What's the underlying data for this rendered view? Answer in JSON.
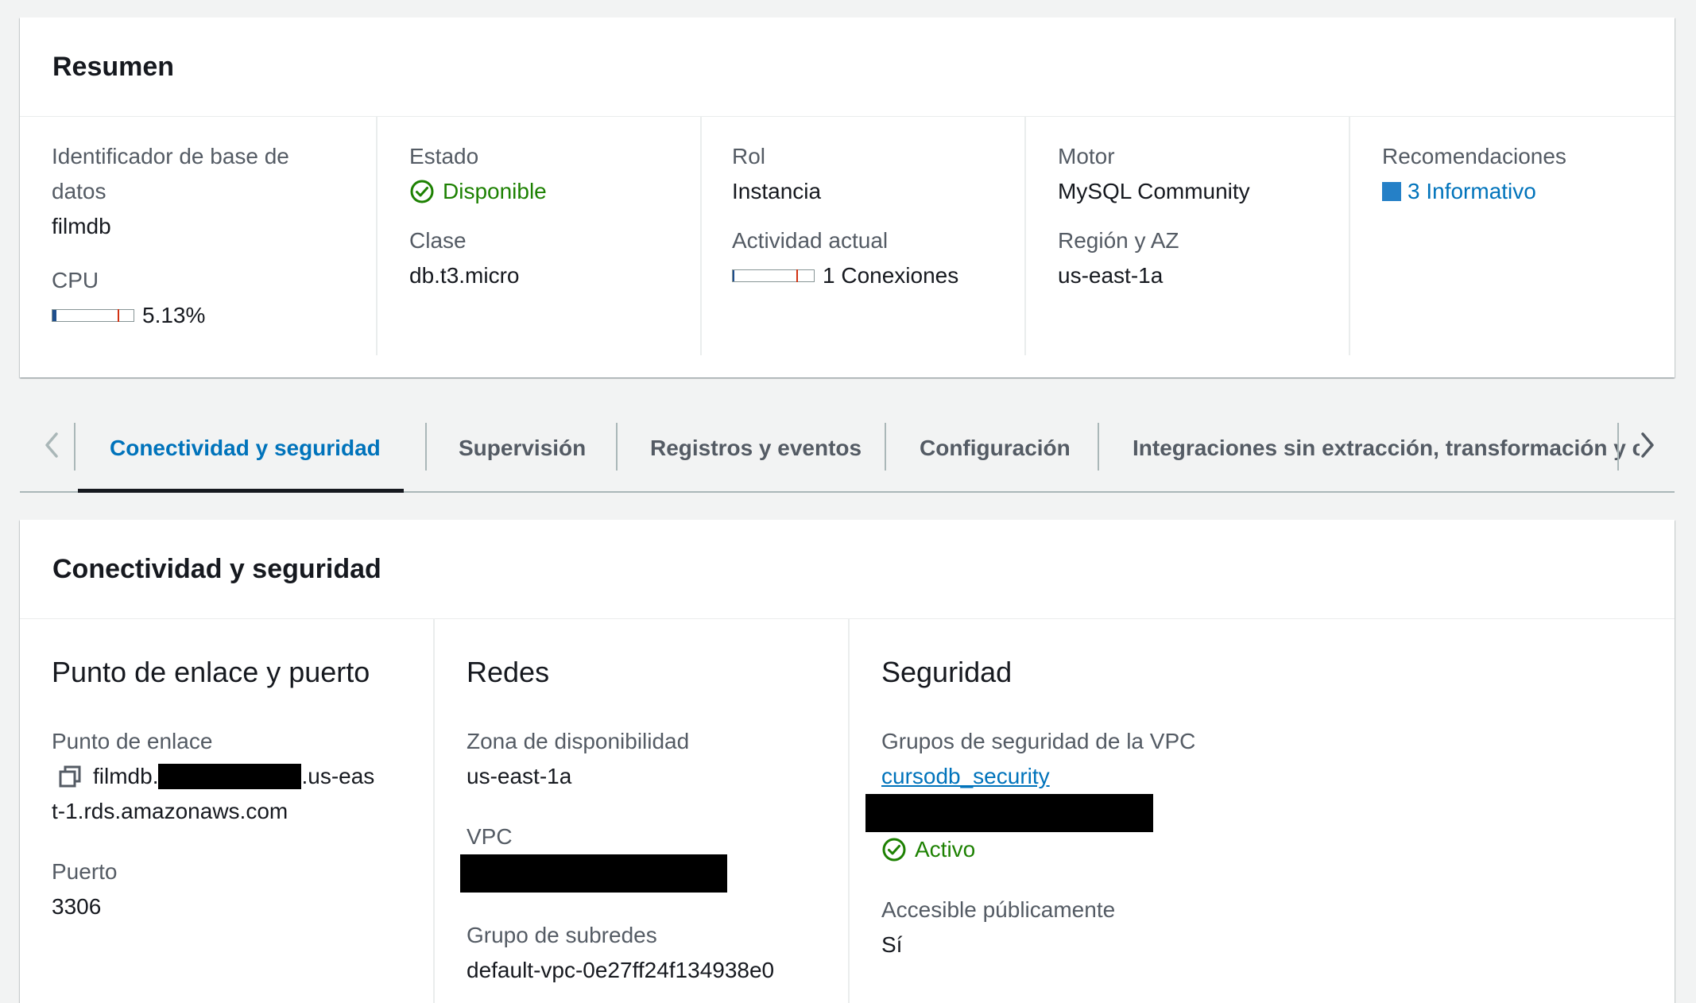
{
  "summary": {
    "title": "Resumen",
    "identifier": {
      "label": "Identificador de base de datos",
      "label_line1": "Identificador de base de",
      "label_line2": "datos",
      "value": "filmdb"
    },
    "cpu": {
      "label": "CPU",
      "value": "5.13%",
      "percent": 5.13
    },
    "status": {
      "label": "Estado",
      "value": "Disponible"
    },
    "class": {
      "label": "Clase",
      "value": "db.t3.micro"
    },
    "role": {
      "label": "Rol",
      "value": "Instancia"
    },
    "activity": {
      "label": "Actividad actual",
      "value": "1 Conexiones"
    },
    "engine": {
      "label": "Motor",
      "value": "MySQL Community"
    },
    "region": {
      "label": "Región y AZ",
      "value": "us-east-1a"
    },
    "recommendations": {
      "label": "Recomendaciones",
      "value": "3 Informativo"
    }
  },
  "tabs": [
    {
      "label": "Conectividad y seguridad",
      "active": true
    },
    {
      "label": "Supervisión",
      "active": false
    },
    {
      "label": "Registros y eventos",
      "active": false
    },
    {
      "label": "Configuración",
      "active": false
    },
    {
      "label": "Integraciones sin extracción, transformación y carga",
      "active": false
    }
  ],
  "connectivity": {
    "title": "Conectividad y seguridad",
    "endpoint_section": {
      "title": "Punto de enlace y puerto",
      "endpoint_label": "Punto de enlace",
      "endpoint_prefix": "filmdb.",
      "endpoint_suffix": ".us-eas",
      "endpoint_line2": "t-1.rds.amazonaws.com",
      "port_label": "Puerto",
      "port_value": "3306"
    },
    "network_section": {
      "title": "Redes",
      "az_label": "Zona de disponibilidad",
      "az_value": "us-east-1a",
      "vpc_label": "VPC",
      "subnet_label": "Grupo de subredes",
      "subnet_value": "default-vpc-0e27ff24f134938e0"
    },
    "security_section": {
      "title": "Seguridad",
      "sg_label": "Grupos de seguridad de la VPC",
      "sg_link": "cursodb_security",
      "sg_status": "Activo",
      "public_label": "Accesible públicamente",
      "public_value": "Sí"
    }
  },
  "colors": {
    "link": "#0073bb",
    "success": "#1d8102",
    "info": "#2580c7",
    "meter_fill": "#1f4e8c",
    "meter_threshold": "#d13212"
  }
}
